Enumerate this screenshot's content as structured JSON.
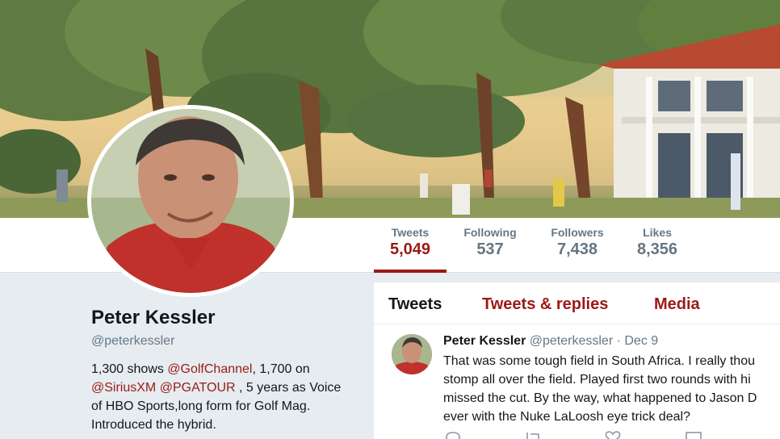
{
  "profile": {
    "name": "Peter Kessler",
    "handle": "@peterkessler",
    "bio": {
      "t1": "1,300 shows ",
      "l1": "@GolfChannel",
      "t2": ", 1,700 on",
      "l2": "@SiriusXM",
      "t3": " ",
      "l3": "@PGATOUR",
      "t4": " , 5 years as Voice of HBO Sports,long form for Golf Mag. Introduced the hybrid."
    }
  },
  "stats": [
    {
      "label": "Tweets",
      "value": "5,049"
    },
    {
      "label": "Following",
      "value": "537"
    },
    {
      "label": "Followers",
      "value": "7,438"
    },
    {
      "label": "Likes",
      "value": "8,356"
    }
  ],
  "tabs": {
    "tweets": "Tweets",
    "replies": "Tweets & replies",
    "media": "Media"
  },
  "tweet": {
    "name": "Peter Kessler",
    "meta": "@peterkessler · Dec 9",
    "lines": [
      "That was some tough field in South Africa. I really thou",
      "stomp all over the field. Played first two rounds with hi",
      "missed the cut. By the way, what happened to Jason D",
      "ever with the Nuke LaLoosh eye trick deal?"
    ]
  },
  "colors": {
    "accent": "#9b1a16",
    "muted": "#657786",
    "page_background": "#e6ecf0"
  },
  "icons": [
    "reply-icon",
    "retweet-icon",
    "like-icon",
    "message-icon"
  ]
}
